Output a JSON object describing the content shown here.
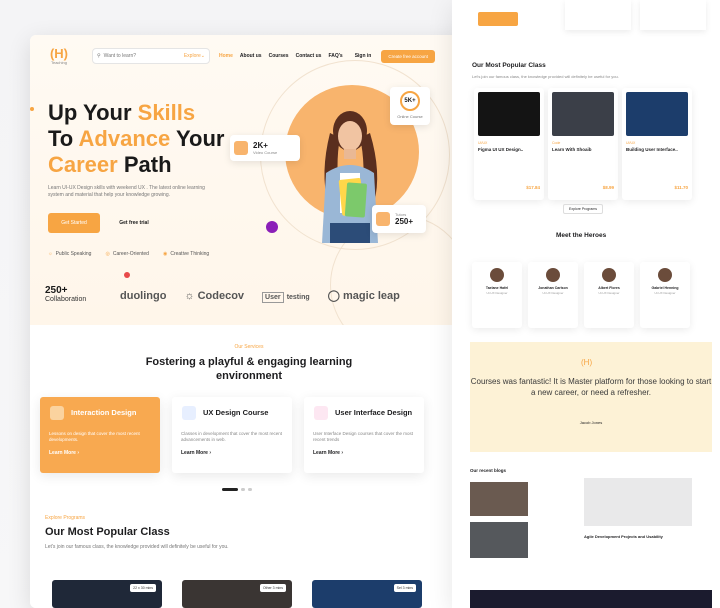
{
  "colors": {
    "accent": "#f7a543",
    "dark": "#1a1a1a"
  },
  "nav": {
    "logo_text": "Teaching",
    "search_placeholder": "Want to learn?",
    "search_category": "Explore",
    "links": [
      "Home",
      "About us",
      "Courses",
      "Contact us",
      "FAQ's"
    ],
    "signin": "Sign in",
    "cta": "Create free account"
  },
  "hero": {
    "line1a": "Up Your ",
    "line1b": "Skills",
    "line2a": "To ",
    "line2b": "Advance",
    "line2c": " Your",
    "line3a": "Career",
    "line3b": " Path",
    "lead": "Learn UI-UX Design skills with weekend UX . The latest online learning system and material that help your knowledge growing.",
    "btn_primary": "Get Started",
    "btn_ghost": "Get free trial",
    "features": [
      "Public Speaking",
      "Career-Oriented",
      "Creative Thinking"
    ],
    "stat_courses_value": "5K+",
    "stat_courses_label": "Online Course",
    "stat_video_value": "2K+",
    "stat_video_label": "Video Course",
    "stat_tutor_label": "Tutors",
    "stat_tutor_value": "250+"
  },
  "collab": {
    "number": "250+",
    "label": "Collaboration",
    "brands": [
      "duolingo",
      "Codecov",
      "User",
      "testing",
      "magic leap"
    ]
  },
  "services": {
    "kicker": "Our Services",
    "title_line1": "Fostering a playful & engaging learning",
    "title_line2": "environment",
    "cards": [
      {
        "title": "Interaction Design",
        "desc": "Lessons on design that cover the most recent developments.",
        "link": "Learn More"
      },
      {
        "title": "UX Design Course",
        "desc": "Classes in development that cover the most recent advancements in web.",
        "link": "Learn More"
      },
      {
        "title": "User Interface Design",
        "desc": "User Interface Design courses that cover the most recent trends",
        "link": "Learn More"
      }
    ]
  },
  "popular": {
    "kicker": "Explore Programs",
    "title": "Our Most Popular Class",
    "subtitle": "Let's join our famous class, the knowledge provided will definitely be useful for you.",
    "badges": [
      "22 x 30 mins",
      "Other 3 mins",
      "Sel 3 mins"
    ]
  },
  "right": {
    "popular_title": "Our Most Popular Class",
    "popular_sub": "Let's join our famous class, the knowledge provided will definitely be useful for you.",
    "course_cards": [
      {
        "tag": "UI/UX",
        "name": "Figma UI UX Design..",
        "price": "$17.84"
      },
      {
        "tag": "Code",
        "name": "Learn With Shoaib",
        "price": "$8.99"
      },
      {
        "tag": "UI/UX",
        "name": "Building User Interface..",
        "price": "$11.70"
      }
    ],
    "explore_btn": "Explore Programs",
    "heroes_title": "Meet the Heroes",
    "heroes": [
      {
        "name": "Taelane Hafel",
        "role": "UI-UX Designer"
      },
      {
        "name": "Jonathan Carlson",
        "role": "UI-UX Designer"
      },
      {
        "name": "Albert Flores",
        "role": "UI-UX Designer"
      },
      {
        "name": "Gabriel Henning",
        "role": "UI-UX Designer"
      }
    ],
    "testimonial": "Courses was fantastic! It is Master platform for those looking to start a new career, or need a refresher.",
    "testimonial_author": "Jacob Jones",
    "recent_title": "Our recent blogs",
    "blog_main": "Agile Development Projects and Usability"
  }
}
